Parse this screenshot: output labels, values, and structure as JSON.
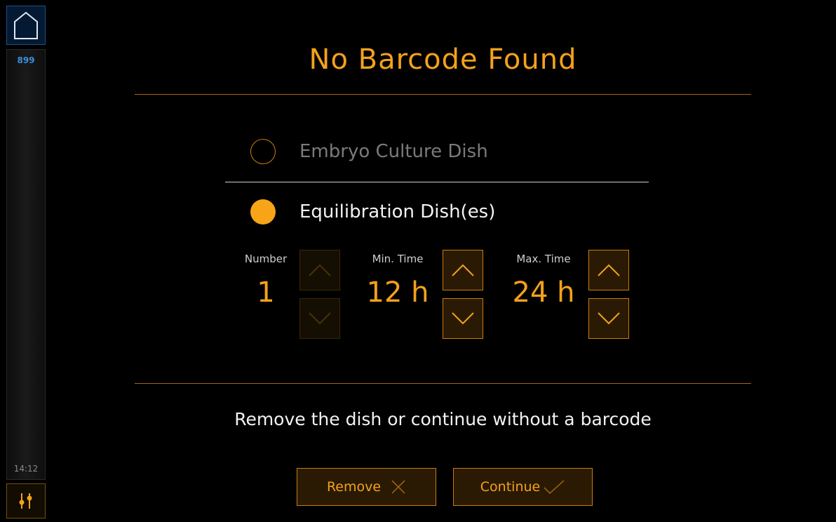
{
  "sidebar": {
    "home_icon": "home-icon",
    "counter": "899",
    "time": "14:12",
    "settings_icon": "sliders-icon"
  },
  "dialog": {
    "title": "No Barcode Found",
    "options": [
      {
        "label": "Embryo Culture Dish",
        "selected": false
      },
      {
        "label": "Equilibration Dish(es)",
        "selected": true
      }
    ],
    "fields": {
      "number": {
        "label": "Number",
        "value": "1",
        "enabled": false
      },
      "min_time": {
        "label": "Min. Time",
        "value": "12 h",
        "enabled": true
      },
      "max_time": {
        "label": "Max. Time",
        "value": "24 h",
        "enabled": true
      }
    },
    "message": "Remove the dish or continue without a barcode",
    "buttons": {
      "remove": "Remove",
      "continue": "Continue"
    }
  },
  "colors": {
    "accent": "#f5a11b",
    "home_blue": "#3b8fe0",
    "background": "#000000"
  }
}
